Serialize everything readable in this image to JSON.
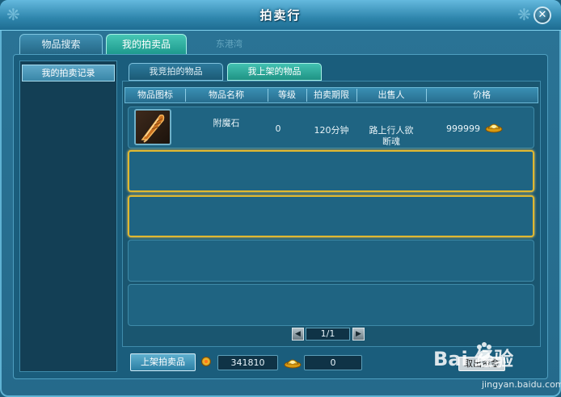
{
  "window": {
    "title": "拍卖行",
    "close_icon": "close-icon"
  },
  "top_tabs": [
    {
      "label": "物品搜索",
      "active": false
    },
    {
      "label": "我的拍卖品",
      "active": true
    }
  ],
  "map_label": "东港湾",
  "left_panel": {
    "items": [
      {
        "label": "我的拍卖记录",
        "selected": true
      }
    ]
  },
  "sub_tabs": [
    {
      "label": "我竞拍的物品",
      "active": false
    },
    {
      "label": "我上架的物品",
      "active": true
    }
  ],
  "table": {
    "headers": [
      "物品图标",
      "物品名称",
      "等级",
      "拍卖期限",
      "出售人",
      "价格"
    ],
    "rows": [
      {
        "icon": "feather-quill-item-icon",
        "name": "附魔石",
        "level": "0",
        "duration": "120分钟",
        "seller_line1": "路上行人欲",
        "seller_line2": "断魂",
        "price": "999999",
        "currency_icon": "gold-ingot-icon"
      }
    ],
    "empty_rows": 4,
    "selected_rows": [
      1,
      2
    ]
  },
  "pager": {
    "text": "1/1"
  },
  "bottom_bar": {
    "list_button": "上架拍卖品",
    "silver_amount": "341810",
    "gold_amount": "0",
    "overlap_button": "取出资金"
  },
  "watermark": {
    "logo": "Bai 经验",
    "url": "jingyan.baidu.com"
  },
  "colors": {
    "panel_bg": "#1a5d7c",
    "active_tab": "#1e9a8e",
    "selected_row_border": "#e0b830"
  }
}
